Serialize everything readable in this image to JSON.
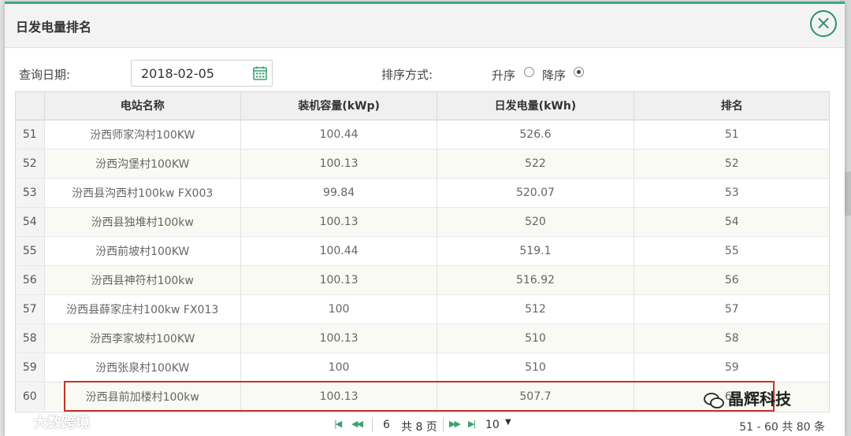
{
  "dialog": {
    "title": "日发电量排名"
  },
  "filter": {
    "date_label": "查询日期:",
    "date_value": "2018-02-05",
    "sort_label": "排序方式:",
    "sort_asc_label": "升序",
    "sort_desc_label": "降序",
    "sort_selected": "降序"
  },
  "table": {
    "columns": [
      "电站名称",
      "装机容量(kWp)",
      "日发电量(kWh)",
      "排名"
    ],
    "rows": [
      {
        "n": "51",
        "name": "汾西师家沟村100KW",
        "capacity": "100.44",
        "energy": "526.6",
        "rank": "51"
      },
      {
        "n": "52",
        "name": "汾西沟堡村100KW",
        "capacity": "100.13",
        "energy": "522",
        "rank": "52"
      },
      {
        "n": "53",
        "name": "汾西县沟西村100kw  FX003",
        "capacity": "99.84",
        "energy": "520.07",
        "rank": "53"
      },
      {
        "n": "54",
        "name": "汾西县独堆村100kw",
        "capacity": "100.13",
        "energy": "520",
        "rank": "54"
      },
      {
        "n": "55",
        "name": "汾西前坡村100KW",
        "capacity": "100.44",
        "energy": "519.1",
        "rank": "55"
      },
      {
        "n": "56",
        "name": "汾西县神符村100kw",
        "capacity": "100.13",
        "energy": "516.92",
        "rank": "56"
      },
      {
        "n": "57",
        "name": "汾西县薛家庄村100kw  FX013",
        "capacity": "100",
        "energy": "512",
        "rank": "57"
      },
      {
        "n": "58",
        "name": "汾西李家坡村100KW",
        "capacity": "100.13",
        "energy": "510",
        "rank": "58"
      },
      {
        "n": "59",
        "name": "汾西张泉村100KW",
        "capacity": "100",
        "energy": "510",
        "rank": "59"
      },
      {
        "n": "60",
        "name": "汾西县前加楼村100kw",
        "capacity": "100.13",
        "energy": "507.7",
        "rank": "60"
      }
    ]
  },
  "pager": {
    "first_icon": "first-page-icon",
    "prev_icon": "prev-page-icon",
    "current_page": "6",
    "total_pages": "共 8 页",
    "next_icon": "next-page-icon",
    "last_icon": "last-page-icon",
    "page_size": "10",
    "info": "51 - 60   共 80 条"
  },
  "watermarks": {
    "left": "大数跨境",
    "right": "晶辉科技"
  },
  "colors": {
    "accent": "#2f8e6e",
    "highlight_box": "#c0352a",
    "alt_row": "#f8faf3"
  }
}
